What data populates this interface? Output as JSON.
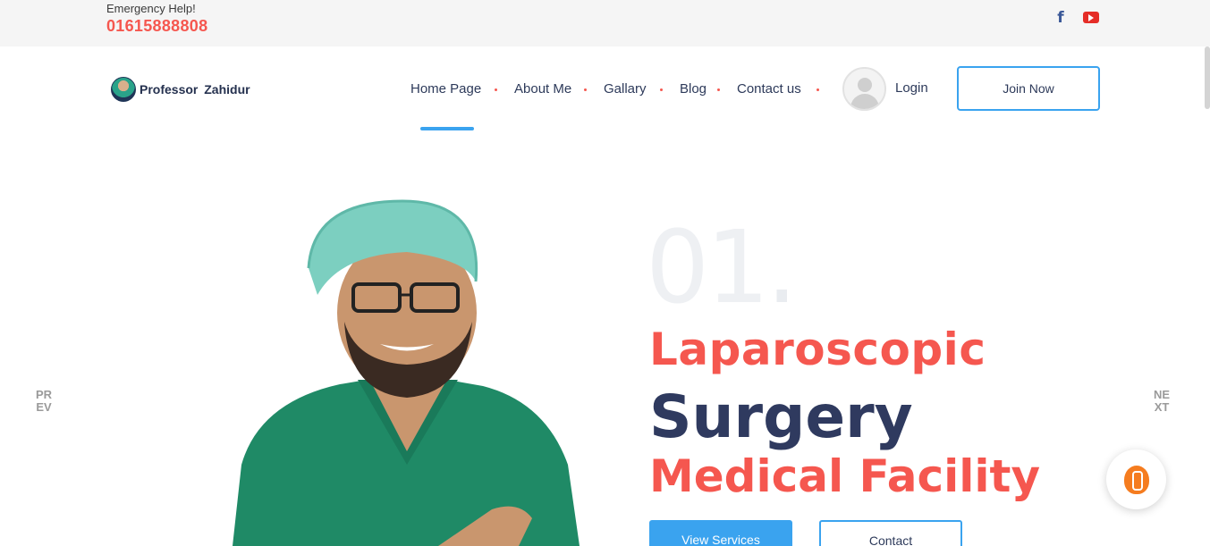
{
  "topbar": {
    "emergency_label": "Emergency Help!",
    "emergency_phone": "01615888808",
    "social": [
      {
        "name": "facebook-icon",
        "glyph": "f"
      },
      {
        "name": "youtube-icon"
      }
    ]
  },
  "header": {
    "logo_text": "Professor Zahidur",
    "nav": [
      "Home Page",
      "About Me",
      "Gallary",
      "Blog",
      "Contact us"
    ],
    "active_nav": "Home Page",
    "login_label": "Login",
    "join_label": "Join Now"
  },
  "hero": {
    "slide_number": "01",
    "slide_dot": ".",
    "line1": "Laparoscopic",
    "line2": "Surgery",
    "line3": "Medical Facility",
    "primary_button": "View Services",
    "secondary_button": "Contact",
    "prev_label": "PR EV",
    "next_label": "NE XT"
  },
  "colors": {
    "accent_red": "#f5574f",
    "accent_blue": "#3aa3ef",
    "heading_navy": "#2f3a5f",
    "chat_orange": "#f57c1f"
  }
}
